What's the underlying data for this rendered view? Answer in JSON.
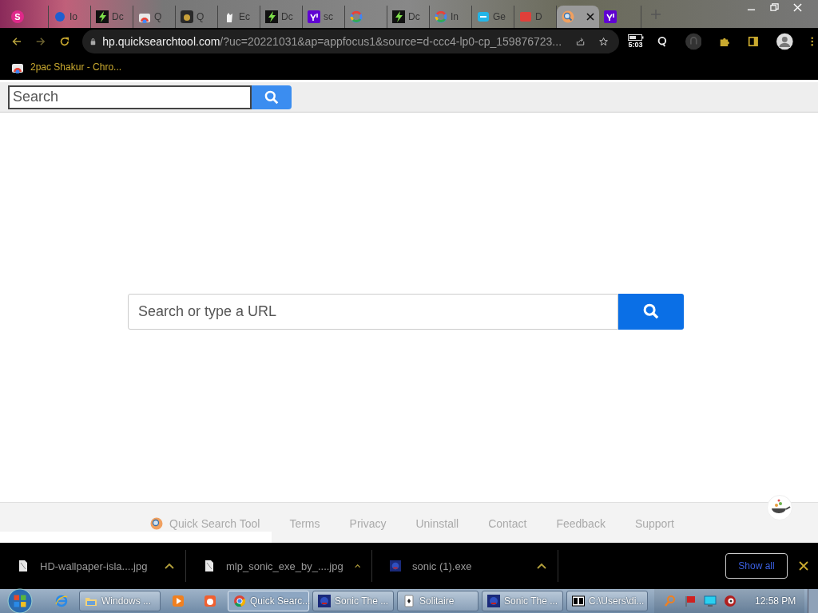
{
  "browser": {
    "tabs": [
      {
        "kind": "letter",
        "badge": "S",
        "selected": false
      },
      {
        "kind": "dot",
        "title": "Io",
        "selected": false
      },
      {
        "kind": "bolt",
        "title": "Dc",
        "selected": false
      },
      {
        "kind": "store",
        "title": "Q",
        "selected": false
      },
      {
        "kind": "disc",
        "title": "Q",
        "selected": false
      },
      {
        "kind": "hand",
        "title": "Ec",
        "selected": false
      },
      {
        "kind": "bolt",
        "title": "Dc",
        "selected": false
      },
      {
        "kind": "yahoo",
        "title": "sc",
        "selected": false
      },
      {
        "kind": "google",
        "selected": false
      },
      {
        "kind": "bolt",
        "title": "Dc",
        "selected": false
      },
      {
        "kind": "google",
        "title": "In",
        "selected": false
      },
      {
        "kind": "cloud",
        "title": "Ge",
        "selected": false
      },
      {
        "kind": "square",
        "title": "D",
        "selected": false
      },
      {
        "kind": "search",
        "selected": true
      },
      {
        "kind": "yahoo",
        "selected": false
      }
    ],
    "url": {
      "host": "hp.quicksearchtool.com",
      "rest": "/?uc=20221031&ap=appfocus1&source=d-ccc4-lp0-cp_159876723..."
    },
    "battery_time": "5:03",
    "bookmarks": [
      {
        "title": "2pac Shakur - Chro..."
      }
    ]
  },
  "page": {
    "header_search": {
      "placeholder": "Search"
    },
    "main_search": {
      "placeholder": "Search or type a URL"
    },
    "footer": {
      "brand": "Quick Search Tool",
      "links": [
        "Terms",
        "Privacy",
        "Uninstall",
        "Contact",
        "Feedback",
        "Support"
      ]
    }
  },
  "downloads": {
    "items": [
      {
        "kind": "file",
        "name": "HD-wallpaper-isla....jpg"
      },
      {
        "kind": "file",
        "name": "mlp_sonic_exe_by_....jpg"
      },
      {
        "kind": "app",
        "name": "sonic (1).exe"
      }
    ],
    "show_all": "Show all"
  },
  "taskbar": {
    "items": [
      {
        "kind": "globe",
        "selected": false
      },
      {
        "kind": "folder",
        "label": "Windows ...",
        "selected": false
      },
      {
        "kind": "player",
        "selected": false
      },
      {
        "kind": "squirrel",
        "selected": false
      },
      {
        "kind": "chrome",
        "label": "Quick Searc...",
        "selected": true
      },
      {
        "kind": "game",
        "label": "Sonic The ...",
        "selected": false
      },
      {
        "kind": "cards",
        "label": "Solitaire",
        "selected": false
      },
      {
        "kind": "game",
        "label": "Sonic The ...",
        "selected": false
      },
      {
        "kind": "archive",
        "label": "C:\\Users\\di...",
        "selected": false
      }
    ],
    "clock": "12:58 PM"
  }
}
